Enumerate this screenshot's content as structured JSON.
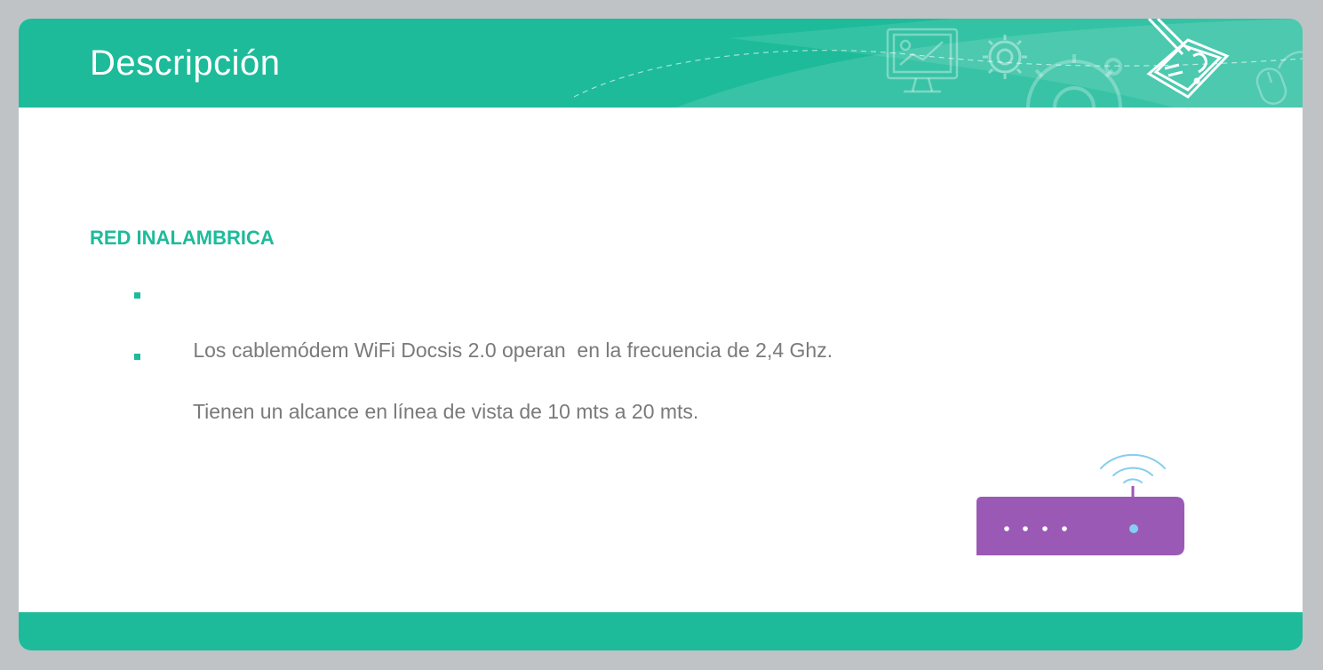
{
  "header": {
    "title": "Descripción"
  },
  "content": {
    "section_heading": "RED INALAMBRICA",
    "bullets": [
      "Los cablemódem WiFi Docsis 2.0 operan  en la frecuencia de 2,4 Ghz.",
      "Tienen un alcance en línea de vista de 10 mts a 20 mts."
    ]
  },
  "icons": {
    "header": [
      "monitor-chart-icon",
      "gear-icon",
      "large-gear-icon",
      "document-pencil-icon",
      "mouse-icon"
    ],
    "illustration": "wifi-router-icon"
  },
  "colors": {
    "accent": "#1dbb9a",
    "text": "#7a7a7a",
    "router": "#9b59b6",
    "wifi": "#86cdf0",
    "background": "#bfc3c6"
  }
}
